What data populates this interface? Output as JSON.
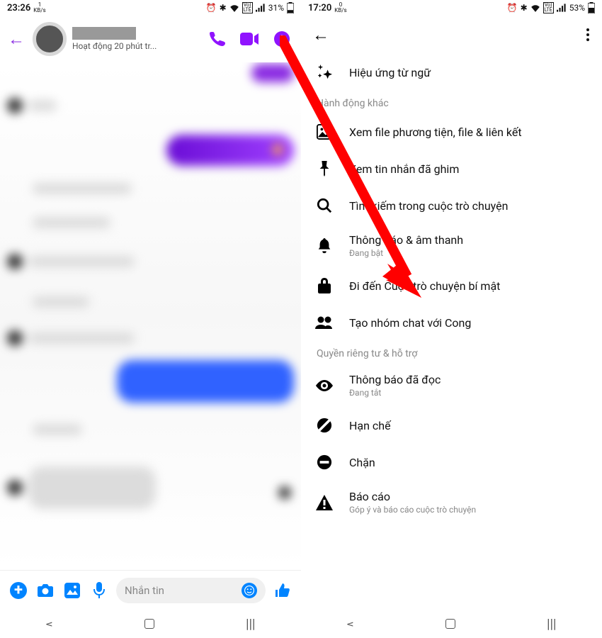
{
  "left_status": {
    "time": "23:26",
    "speed": "1",
    "unit": "KB/s",
    "battery": "31%"
  },
  "right_status": {
    "time": "17:20",
    "speed": "0",
    "unit": "KB/s",
    "battery": "53%"
  },
  "chat": {
    "status_text": "Hoạt động 20 phút tr...",
    "composer_placeholder": "Nhắn tin"
  },
  "settings": {
    "top_item": "Hiệu ứng từ ngữ",
    "section1_header": "Hành động khác",
    "items1": {
      "media": "Xem file phương tiện, file & liên kết",
      "pinned": "Xem tin nhắn đã ghim",
      "search": "Tìm kiếm trong cuộc trò chuyện",
      "notif_title": "Thông báo & âm thanh",
      "notif_sub": "Đang bật",
      "secret": "Đi đến Cuộc trò chuyện bí mật",
      "group": "Tạo nhóm chat với Cong"
    },
    "section2_header": "Quyền riêng tư & hỗ trợ",
    "items2": {
      "read_title": "Thông báo đã đọc",
      "read_sub": "Đang tắt",
      "restrict": "Hạn chế",
      "block": "Chặn",
      "report_title": "Báo cáo",
      "report_sub": "Góp ý và báo cáo cuộc trò chuyện"
    }
  }
}
